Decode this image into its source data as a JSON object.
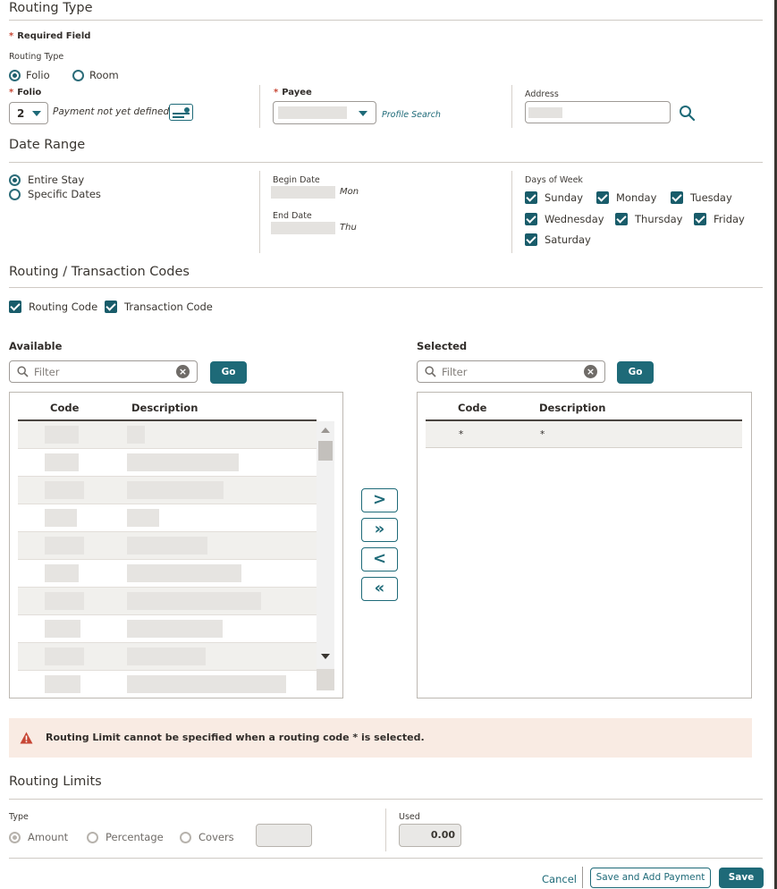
{
  "routing_type": {
    "title": "Routing Type",
    "required_note": "Required Field",
    "type_label": "Routing Type",
    "options": [
      "Folio",
      "Room"
    ],
    "selected": "Folio",
    "folio_label": "Folio",
    "folio_value": "2",
    "payment_text": "Payment not yet defined",
    "payee_label": "Payee",
    "profile_search": "Profile Search",
    "address_label": "Address"
  },
  "date_range": {
    "title": "Date Range",
    "options": [
      "Entire Stay",
      "Specific Dates"
    ],
    "selected": "Entire Stay",
    "begin_label": "Begin Date",
    "begin_day": "Mon",
    "end_label": "End Date",
    "end_day": "Thu",
    "dow_label": "Days of Week",
    "days": [
      "Sunday",
      "Monday",
      "Tuesday",
      "Wednesday",
      "Thursday",
      "Friday",
      "Saturday"
    ]
  },
  "codes": {
    "title": "Routing / Transaction Codes",
    "routing_code": "Routing Code",
    "transaction_code": "Transaction Code",
    "available_label": "Available",
    "selected_label": "Selected",
    "filter_placeholder": "Filter",
    "go": "Go",
    "col_code": "Code",
    "col_desc": "Description",
    "selected_rows": [
      {
        "code": "*",
        "desc": "*"
      }
    ],
    "move_buttons": [
      ">",
      "»",
      "<",
      "«"
    ]
  },
  "warning": {
    "text": "Routing Limit cannot be specified when a routing code * is selected.",
    "color": "#c74634"
  },
  "routing_limits": {
    "title": "Routing Limits",
    "type_label": "Type",
    "options": [
      "Amount",
      "Percentage",
      "Covers"
    ],
    "used_label": "Used",
    "used_value": "0.00"
  },
  "footer": {
    "cancel": "Cancel",
    "save_add_payment": "Save and Add Payment",
    "save": "Save"
  },
  "colors": {
    "accent": "#1e6a78",
    "warning_bg": "#f9ebe3"
  }
}
